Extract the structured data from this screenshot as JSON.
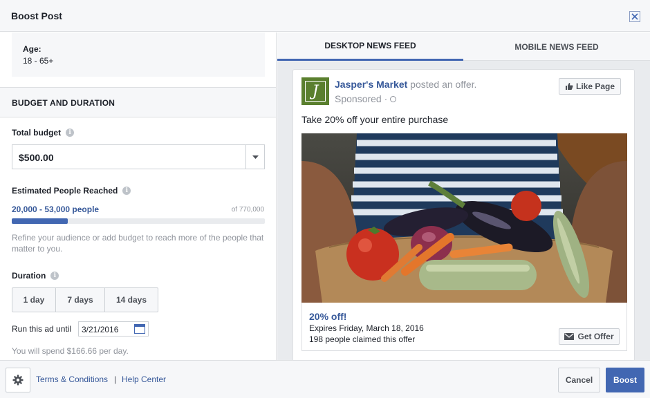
{
  "header": {
    "title": "Boost Post"
  },
  "audience": {
    "age_label": "Age:",
    "age_value": "18 - 65+"
  },
  "budget_section": {
    "heading": "BUDGET AND DURATION",
    "total_budget_label": "Total budget",
    "total_budget_value": "$500.00",
    "reach_label": "Estimated People Reached",
    "reach_range": "20,000 - 53,000 people",
    "reach_of": "of 770,000",
    "reach_fraction": 0.22,
    "reach_note": "Refine your audience or add budget to reach more of the people that matter to you.",
    "duration_label": "Duration",
    "durations": [
      "1 day",
      "7 days",
      "14 days"
    ],
    "run_until_label": "Run this ad until",
    "run_until_date": "3/21/2016",
    "spend_text": "You will spend $166.66 per day."
  },
  "preview": {
    "tabs": [
      "DESKTOP NEWS FEED",
      "MOBILE NEWS FEED"
    ],
    "active_tab": 0,
    "page_name": "Jasper's Market",
    "action_text": "posted an offer.",
    "sponsored": "Sponsored ·",
    "like_button": "Like Page",
    "post_text": "Take 20% off your entire purchase",
    "offer_title": "20% off!",
    "offer_expires": "Expires Friday, March 18, 2016",
    "offer_claimed": "198 people claimed this offer",
    "get_offer_button": "Get Offer",
    "brand_color": "#5a7f2e"
  },
  "footer": {
    "terms_link": "Terms & Conditions",
    "separator": "|",
    "help_link": "Help Center",
    "cancel_button": "Cancel",
    "boost_button": "Boost"
  },
  "colors": {
    "accent": "#4267b2",
    "link": "#365899"
  }
}
